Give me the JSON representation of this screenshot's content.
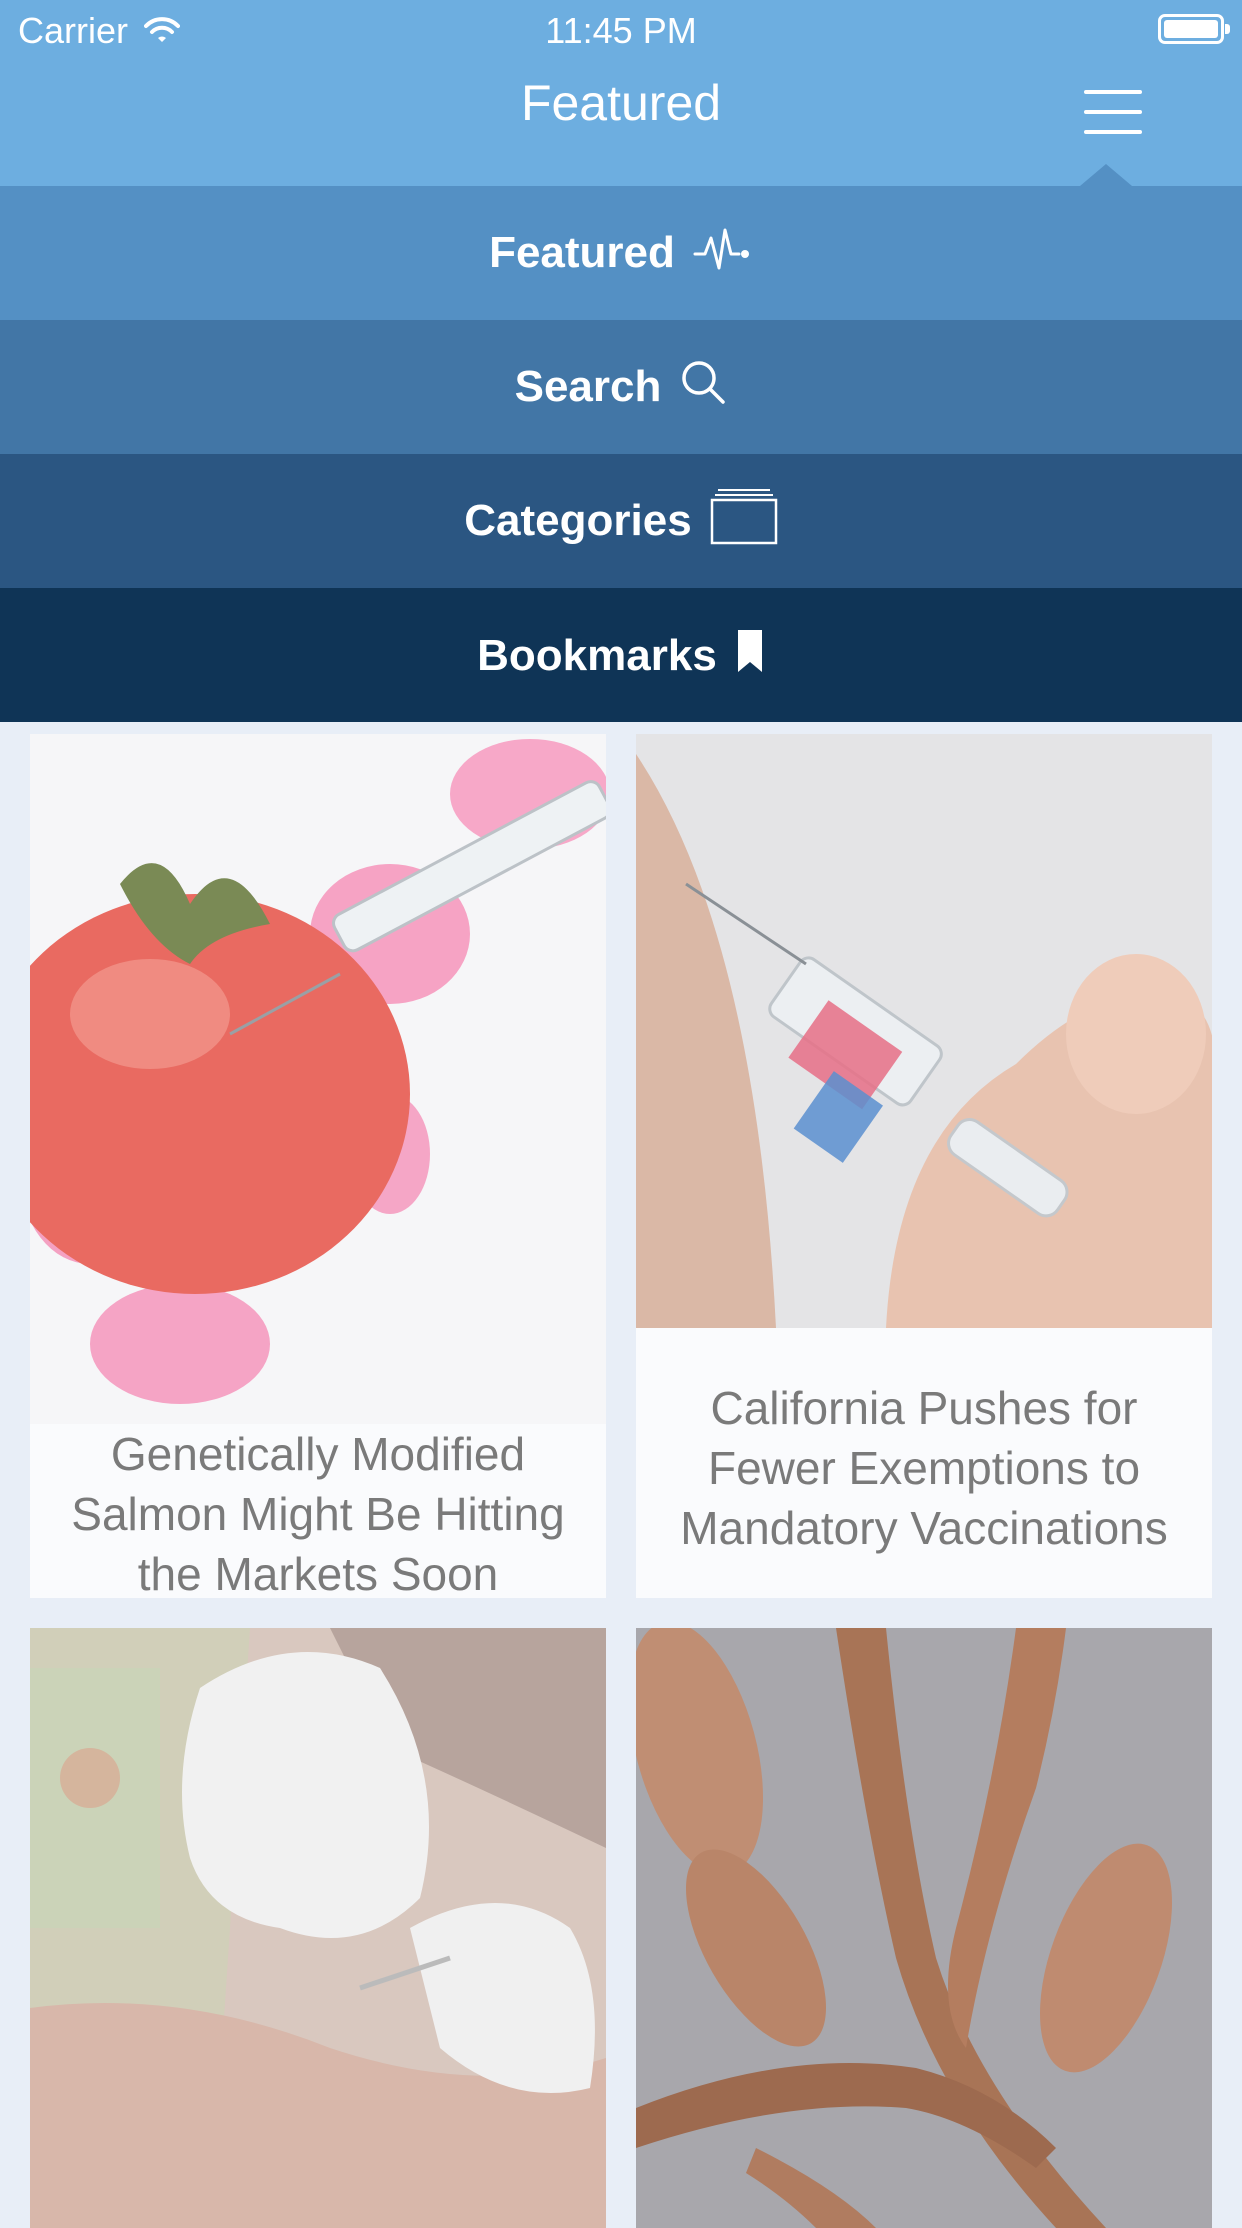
{
  "status_bar": {
    "carrier": "Carrier",
    "time": "11:45 PM"
  },
  "nav": {
    "title": "Featured"
  },
  "menu": {
    "items": [
      {
        "label": "Featured",
        "icon": "pulse-icon"
      },
      {
        "label": "Search",
        "icon": "search-icon"
      },
      {
        "label": "Categories",
        "icon": "folder-icon"
      },
      {
        "label": "Bookmarks",
        "icon": "bookmark-icon"
      }
    ]
  },
  "articles": [
    {
      "title": "Genetically Modified Salmon Might Be Hitting the Markets Soon",
      "image": "tomato-syringe"
    },
    {
      "title": "California Pushes for Fewer Exemptions to Mandatory Vaccinations",
      "image": "vaccine-syringe"
    },
    {
      "title": "",
      "image": "gloved-hands"
    },
    {
      "title": "",
      "image": "kelp-on-sand"
    }
  ],
  "colors": {
    "nav_bar": "#6daee0",
    "menu_featured": "#5490c4",
    "menu_search": "#4276a6",
    "menu_categories": "#2b5682",
    "menu_bookmarks": "#0f3456"
  }
}
